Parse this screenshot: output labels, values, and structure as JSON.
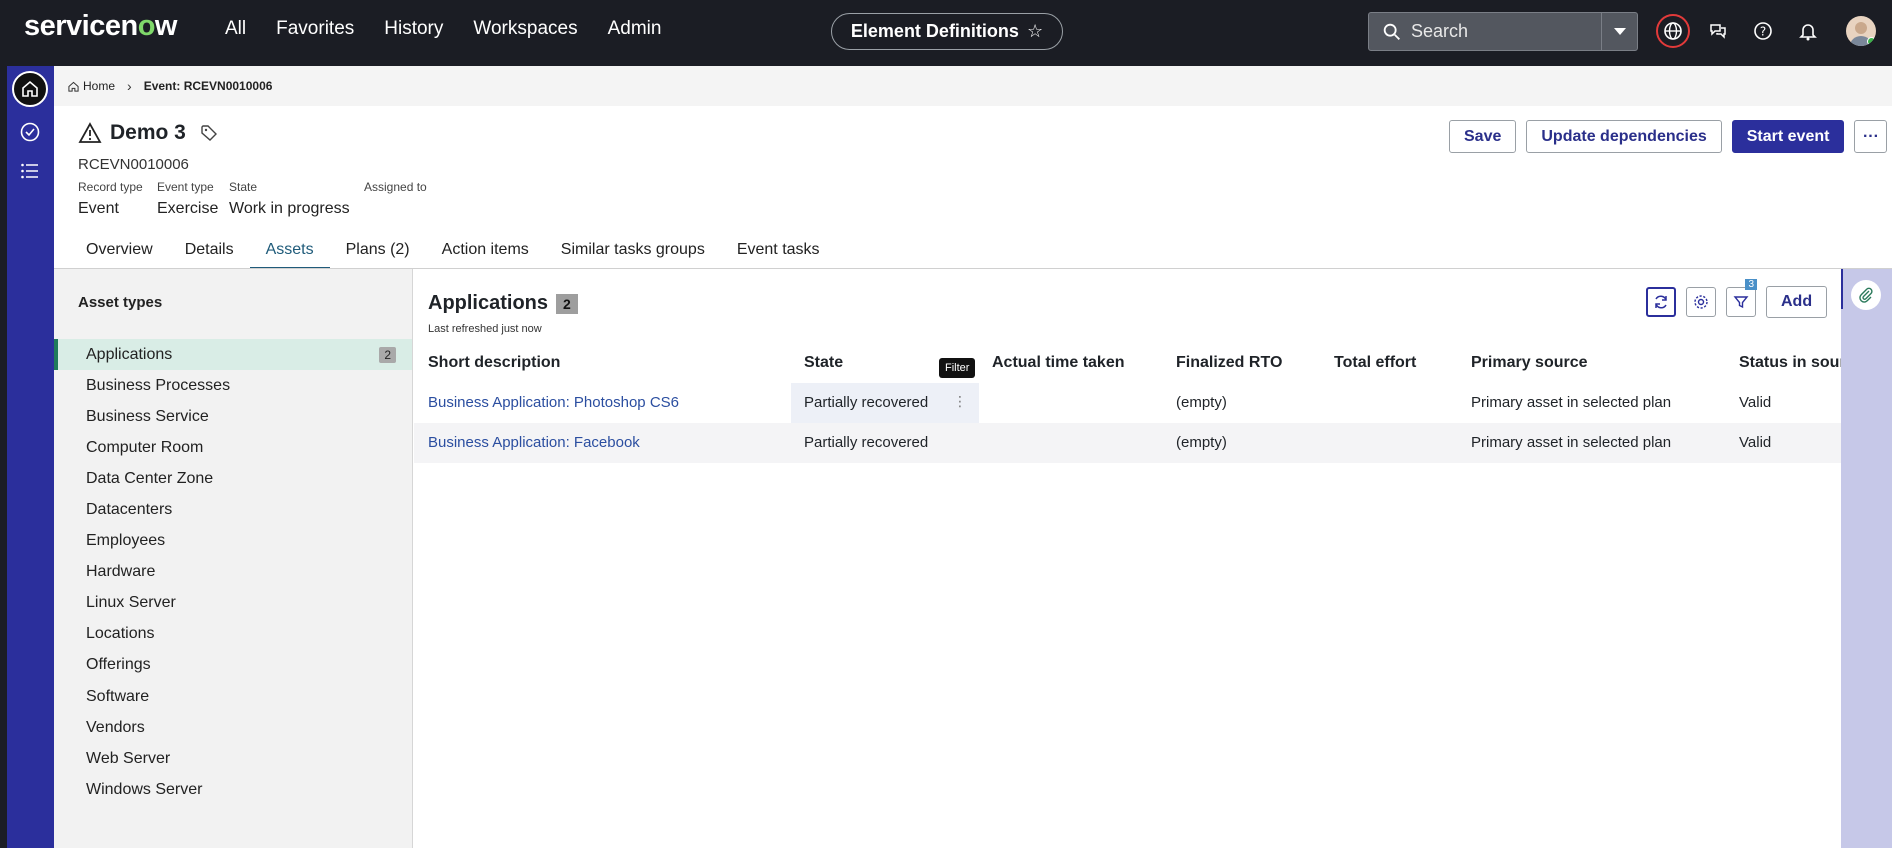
{
  "brand": {
    "name_pre": "servicen",
    "name_o": "o",
    "name_post": "w"
  },
  "nav": [
    "All",
    "Favorites",
    "History",
    "Workspaces",
    "Admin"
  ],
  "context_pill": "Element Definitions",
  "search": {
    "placeholder": "Search"
  },
  "breadcrumb": {
    "home": "Home",
    "current": "Event: RCEVN0010006"
  },
  "record": {
    "title": "Demo 3",
    "number": "RCEVN0010006",
    "fields": [
      {
        "label": "Record type",
        "value": "Event"
      },
      {
        "label": "Event type",
        "value": "Exercise"
      },
      {
        "label": "State",
        "value": "Work in progress"
      },
      {
        "label": "Assigned to",
        "value": ""
      }
    ]
  },
  "actions": {
    "save": "Save",
    "update": "Update dependencies",
    "start": "Start event",
    "more": "···"
  },
  "tabs": [
    "Overview",
    "Details",
    "Assets",
    "Plans (2)",
    "Action items",
    "Similar tasks groups",
    "Event tasks"
  ],
  "asset_types": {
    "heading": "Asset types",
    "items": [
      "Applications",
      "Business Processes",
      "Business Service",
      "Computer Room",
      "Data Center Zone",
      "Datacenters",
      "Employees",
      "Hardware",
      "Linux Server",
      "Locations",
      "Offerings",
      "Software",
      "Vendors",
      "Web Server",
      "Windows Server"
    ],
    "active_count": "2"
  },
  "content": {
    "title": "Applications",
    "count": "2",
    "refreshed": "Last refreshed just now",
    "filter_badge": "3",
    "add": "Add",
    "tooltip": "Filter",
    "columns": [
      "Short description",
      "State",
      "Actual time taken",
      "Finalized RTO",
      "Total effort",
      "Primary source",
      "Status in source"
    ],
    "rows": [
      [
        "Business Application: Photoshop CS6",
        "Partially recovered",
        "",
        "(empty)",
        "",
        "Primary asset in selected plan",
        "Valid"
      ],
      [
        "Business Application: Facebook",
        "Partially recovered",
        "",
        "(empty)",
        "",
        "Primary asset in selected plan",
        "Valid"
      ]
    ]
  }
}
